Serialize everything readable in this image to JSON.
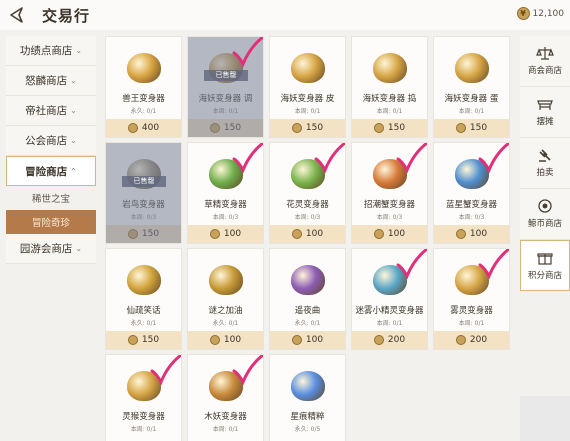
{
  "header": {
    "title": "交易行",
    "currency_amount": "12,100"
  },
  "left_nav": {
    "items": [
      {
        "label": "功绩点商店",
        "chevron": "⌄"
      },
      {
        "label": "怒麟商店",
        "chevron": "⌄"
      },
      {
        "label": "帝社商店",
        "chevron": "⌄"
      },
      {
        "label": "公会商店",
        "chevron": "⌄"
      },
      {
        "label": "冒险商店",
        "chevron": "⌃"
      }
    ],
    "sub_items": [
      {
        "label": "稀世之宝"
      },
      {
        "label": "冒险奇珍"
      }
    ],
    "last_item": {
      "label": "园游会商店",
      "chevron": "⌄"
    }
  },
  "right_nav": {
    "items": [
      {
        "label": "商会商店",
        "icon": "scale-icon"
      },
      {
        "label": "摆摊",
        "icon": "stall-icon"
      },
      {
        "label": "拍卖",
        "icon": "gavel-icon"
      },
      {
        "label": "鲸币商店",
        "icon": "whale-coin-icon"
      },
      {
        "label": "积分商店",
        "icon": "points-icon"
      }
    ]
  },
  "sold_label": "已售罄",
  "items": [
    {
      "name": "兽王变身器",
      "limit": "永久: 0/1",
      "price": "400",
      "sold": false,
      "checked": false,
      "color": "#d9a441"
    },
    {
      "name": "海妖变身器 调",
      "limit": "本周: 0/1",
      "price": "150",
      "sold": true,
      "checked": true,
      "color": "#c79a4a"
    },
    {
      "name": "海妖变身器 皮",
      "limit": "本周: 0/1",
      "price": "150",
      "sold": false,
      "checked": false,
      "color": "#d6a545"
    },
    {
      "name": "海妖变身器 捣",
      "limit": "本周: 0/1",
      "price": "150",
      "sold": false,
      "checked": false,
      "color": "#d6a545"
    },
    {
      "name": "海妖变身器 蛋",
      "limit": "本周: 0/1",
      "price": "150",
      "sold": false,
      "checked": false,
      "color": "#d6a545"
    },
    {
      "name": "岩鸟变身器",
      "limit": "本周: 0/3",
      "price": "150",
      "sold": true,
      "checked": false,
      "color": "#9a8f7a"
    },
    {
      "name": "草精变身器",
      "limit": "本周: 0/3",
      "price": "100",
      "sold": false,
      "checked": true,
      "color": "#6fae4c"
    },
    {
      "name": "花灵变身器",
      "limit": "本周: 0/3",
      "price": "100",
      "sold": false,
      "checked": true,
      "color": "#7bb44e"
    },
    {
      "name": "招潮蟹变身器",
      "limit": "本周: 0/3",
      "price": "100",
      "sold": false,
      "checked": true,
      "color": "#d77a3a"
    },
    {
      "name": "蓝星蟹变身器",
      "limit": "本周: 0/3",
      "price": "100",
      "sold": false,
      "checked": true,
      "color": "#4f8fd0"
    },
    {
      "name": "仙疏笑话",
      "limit": "永久: 0/1",
      "price": "150",
      "sold": false,
      "checked": false,
      "color": "#d2a43c"
    },
    {
      "name": "谜之加油",
      "limit": "永久: 0/1",
      "price": "100",
      "sold": false,
      "checked": false,
      "color": "#c89a38"
    },
    {
      "name": "遥夜曲",
      "limit": "永久: 0/1",
      "price": "100",
      "sold": false,
      "checked": false,
      "color": "#8e5db5"
    },
    {
      "name": "迷雾小精灵变身器",
      "limit": "本周: 0/1",
      "price": "200",
      "sold": false,
      "checked": true,
      "color": "#5aa6c8"
    },
    {
      "name": "雾灵变身器",
      "limit": "本周: 0/1",
      "price": "200",
      "sold": false,
      "checked": true,
      "color": "#d6a545"
    },
    {
      "name": "灵猴变身器",
      "limit": "本周: 0/1",
      "price": "",
      "sold": false,
      "checked": true,
      "color": "#d6a545"
    },
    {
      "name": "木妖变身器",
      "limit": "本周: 0/1",
      "price": "",
      "sold": false,
      "checked": true,
      "color": "#c98a3c"
    },
    {
      "name": "星痕精粹",
      "limit": "永久: 0/5",
      "price": "",
      "sold": false,
      "checked": false,
      "color": "#5a8fe0"
    }
  ]
}
